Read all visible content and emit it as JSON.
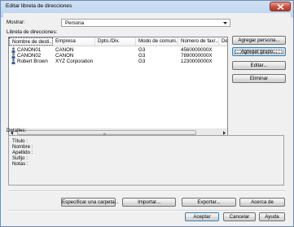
{
  "window": {
    "title": "Editar libreta de direcciones"
  },
  "show": {
    "label": "Mostrar:",
    "value": "Persona"
  },
  "addressbook": {
    "label": "Libreta de direcciones:",
    "columns": [
      "Nombre de desti...",
      "Empresa",
      "Dpto./Div.",
      "Modo de comuni...",
      "Número de fax/...",
      "Desi"
    ],
    "rows": [
      {
        "name": "CANON01",
        "company": "CANON",
        "dept": "",
        "mode": "G3",
        "fax": "4560000000X"
      },
      {
        "name": "CANON02",
        "company": "CANON",
        "dept": "",
        "mode": "G3",
        "fax": "7890000000X"
      },
      {
        "name": "Robert Brown",
        "company": "XYZ Corporation",
        "dept": "",
        "mode": "G3",
        "fax": "1230000000X"
      }
    ],
    "scroll_grip": "III"
  },
  "side_buttons": {
    "add_person": "Agregar persona...",
    "add_group": "Agregar grupo...",
    "edit": "Editar...",
    "delete": "Eliminar"
  },
  "details": {
    "label": "Detalles:",
    "fields": [
      "Título :",
      "Nombre :",
      "Apellido :",
      "Sufijo :",
      "Notas :"
    ]
  },
  "bottom_buttons": {
    "specify_folder": "Especificar una carpeta...",
    "import": "Importar...",
    "export": "Exportar...",
    "about": "Acerca de"
  },
  "dialog_buttons": {
    "accept": "Aceptar",
    "cancel": "Cancelar",
    "help": "Ayuda"
  }
}
